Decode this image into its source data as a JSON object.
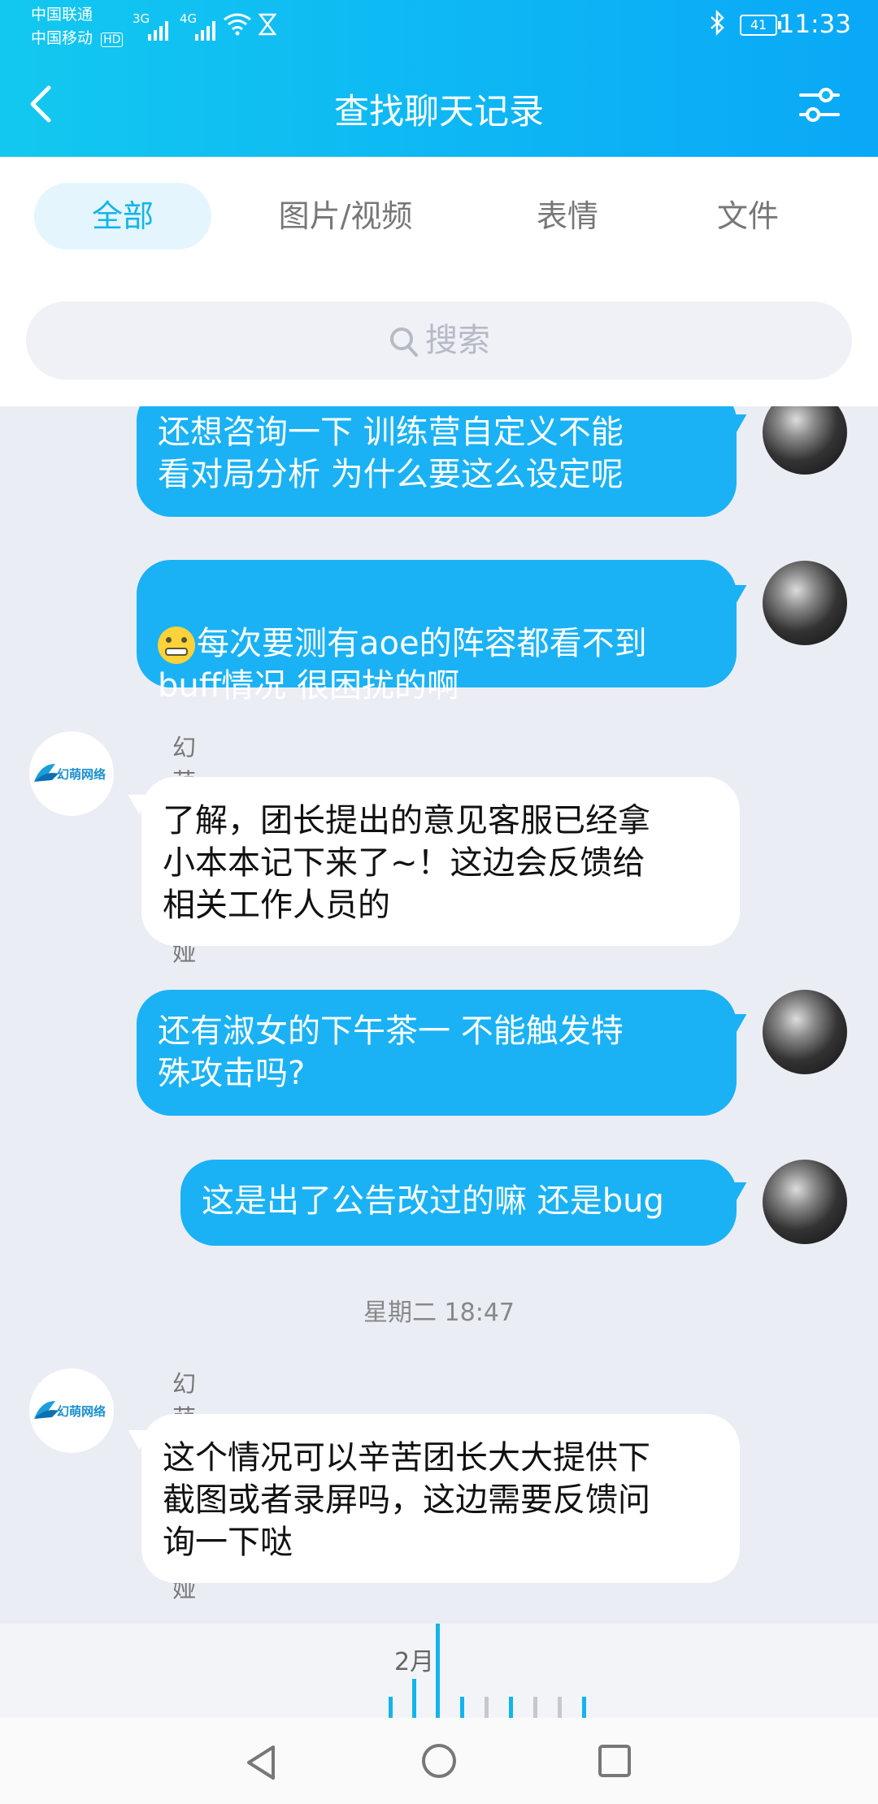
{
  "status_bar": {
    "carrier1": "中国联通",
    "carrier2": "中国移动",
    "hd": "HD",
    "net1": "3G",
    "net2": "4G",
    "battery": "41",
    "time": "11:33"
  },
  "header": {
    "title": "查找聊天记录"
  },
  "tabs": [
    {
      "label": "全部",
      "active": true
    },
    {
      "label": "图片/视频",
      "active": false
    },
    {
      "label": "表情",
      "active": false
    },
    {
      "label": "文件",
      "active": false
    }
  ],
  "search": {
    "placeholder": "搜索"
  },
  "messages": [
    {
      "dir": "out",
      "text": "还想咨询一下 训练营自定义不能\n看对局分析 为什么要这么设定呢"
    },
    {
      "dir": "out",
      "text_line1": "每次要测有aoe的阵容都看不到",
      "text_line2": "buff情况 很困扰的啊"
    },
    {
      "dir": "in",
      "sender": "幻萌网络-卡莉娅",
      "text": "了解，团长提出的意见客服已经拿\n小本本记下来了~！这边会反馈给\n相关工作人员的"
    },
    {
      "dir": "out",
      "text": "还有淑女的下午茶一 不能触发特\n殊攻击吗?"
    },
    {
      "dir": "out",
      "text": "这是出了公告改过的嘛 还是bug"
    },
    {
      "timestamp": "星期二 18:47"
    },
    {
      "dir": "in",
      "sender": "幻萌网络-卡莉娅",
      "text": "这个情况可以辛苦团长大大提供下\n截图或者录屏吗，这边需要反馈问\n询一下哒"
    }
  ],
  "service_logo_text": "幻萌网络",
  "timeline_bar": {
    "month_label": "2月"
  },
  "colors": {
    "accent": "#1ab2f5",
    "header_start": "#12c8f0",
    "header_end": "#0aa8f7",
    "bg": "#ebedf5"
  }
}
